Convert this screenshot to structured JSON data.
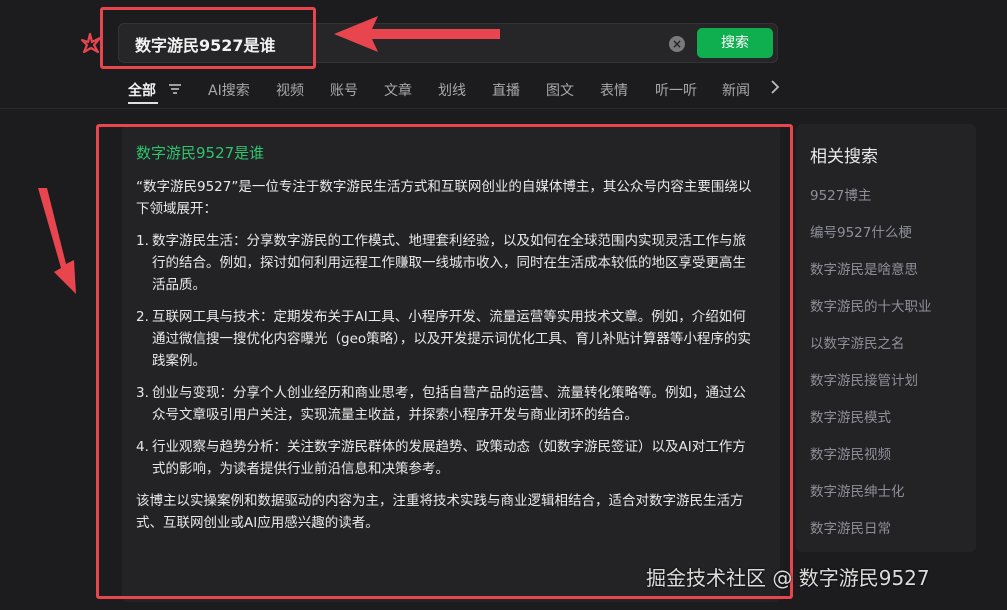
{
  "search": {
    "query": "数字游民9527是谁",
    "button_label": "搜索"
  },
  "tabs": [
    {
      "label": "全部"
    },
    {
      "label": "AI搜索"
    },
    {
      "label": "视频"
    },
    {
      "label": "账号"
    },
    {
      "label": "文章"
    },
    {
      "label": "划线"
    },
    {
      "label": "直播"
    },
    {
      "label": "图文"
    },
    {
      "label": "表情"
    },
    {
      "label": "听一听"
    },
    {
      "label": "新闻"
    }
  ],
  "answer": {
    "title": "数字游民9527是谁",
    "intro": "“数字游民9527”是一位专注于数字游民生活方式和互联网创业的自媒体博主，其公众号内容主要围绕以下领域展开：",
    "items": [
      {
        "num": "1.",
        "text": "数字游民生活：分享数字游民的工作模式、地理套利经验，以及如何在全球范围内实现灵活工作与旅行的结合。例如，探讨如何利用远程工作赚取一线城市收入，同时在生活成本较低的地区享受更高生活品质。"
      },
      {
        "num": "2.",
        "text": "互联网工具与技术：定期发布关于AI工具、小程序开发、流量运营等实用技术文章。例如，介绍如何通过微信搜一搜优化内容曝光（geo策略），以及开发提示词优化工具、育儿补贴计算器等小程序的实践案例。"
      },
      {
        "num": "3.",
        "text": "创业与变现：分享个人创业经历和商业思考，包括自营产品的运营、流量转化策略等。例如，通过公众号文章吸引用户关注，实现流量主收益，并探索小程序开发与商业闭环的结合。"
      },
      {
        "num": "4.",
        "text": "行业观察与趋势分析：关注数字游民群体的发展趋势、政策动态（如数字游民签证）以及AI对工作方式的影响，为读者提供行业前沿信息和决策参考。"
      }
    ],
    "conclusion": "该博主以实操案例和数据驱动的内容为主，注重将技术实践与商业逻辑相结合，适合对数字游民生活方式、互联网创业或AI应用感兴趣的读者。"
  },
  "related": {
    "title": "相关搜索",
    "items": [
      {
        "label": "9527博主"
      },
      {
        "label": "编号9527什么梗"
      },
      {
        "label": "数字游民是啥意思"
      },
      {
        "label": "数字游民的十大职业"
      },
      {
        "label": "以数字游民之名"
      },
      {
        "label": "数字游民接管计划"
      },
      {
        "label": "数字游民模式"
      },
      {
        "label": "数字游民视频"
      },
      {
        "label": "数字游民绅士化"
      },
      {
        "label": "数字游民日常"
      }
    ]
  },
  "watermark": "掘金技术社区 @ 数字游民9527",
  "colors": {
    "accent_green": "#0fae4f",
    "title_green": "#2ec46d",
    "annotation_red": "#e8454f",
    "background": "#1c1c1e",
    "card": "#232325"
  },
  "icons": {
    "logo": "sogou-star-logo-icon",
    "clear": "clear-x-icon",
    "filter": "filter-lines-icon",
    "more": "chevron-right-icon"
  }
}
